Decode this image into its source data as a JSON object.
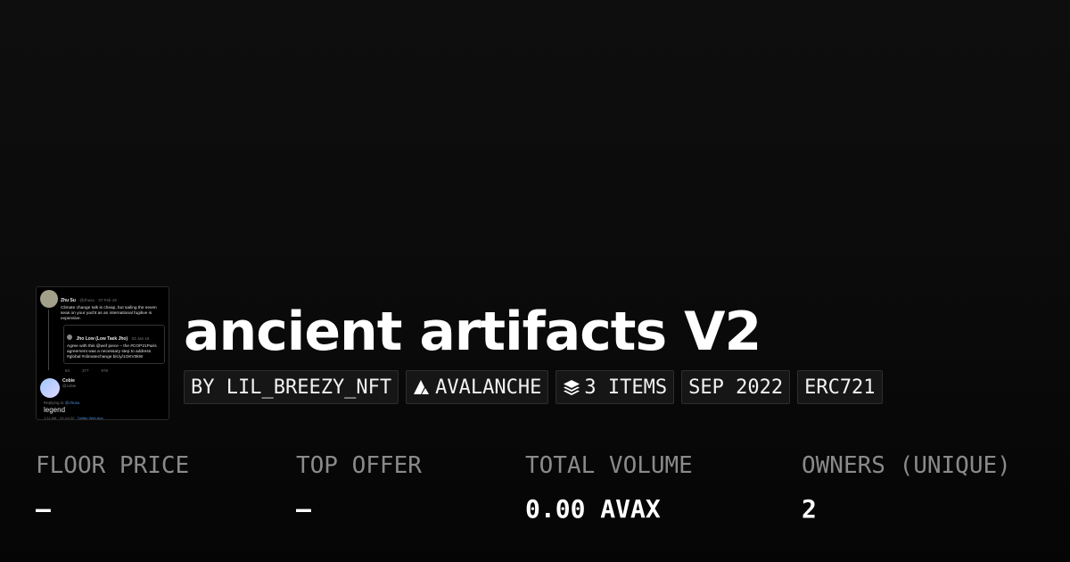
{
  "thumbnail": {
    "tweet": {
      "author": "Zhu Su",
      "handle": "@zhusu",
      "date": "07 Feb 19",
      "text": "Climate change talk is cheap, but sailing the seven seas on your yacht as an international fugitive is expensive."
    },
    "quote": {
      "author": "Jho Low (Low Taek Jho)",
      "date": "03 Jan 16",
      "text": "Agree with this @wef piece – the #COP21Paris agreement was a necessary step to address #global #climatechange bit.ly/1OKV0kW"
    },
    "actions": [
      "94",
      "377",
      "978"
    ],
    "reply": {
      "author": "Cobie",
      "handle": "@cobie",
      "replying_prefix": "Replying to",
      "replying_to": "@zhusu",
      "text": "legend",
      "time": "1:11 AM · 19 Jul 22 ·",
      "client": "Twitter Web App"
    }
  },
  "collection": {
    "title": "ancient artifacts V2",
    "tags": {
      "creator": "BY LIL_BREEZY_NFT",
      "chain": "AVALANCHE",
      "items": "3 ITEMS",
      "date": "SEP 2022",
      "standard": "ERC721"
    }
  },
  "stats": {
    "floor_price": {
      "label": "FLOOR PRICE",
      "value": "–"
    },
    "top_offer": {
      "label": "TOP OFFER",
      "value": "–"
    },
    "total_volume": {
      "label": "TOTAL VOLUME",
      "value": "0.00 AVAX"
    },
    "owners": {
      "label": "OWNERS (UNIQUE)",
      "value": "2"
    }
  },
  "icons": {
    "chain": "avalanche-icon",
    "items": "layers-icon"
  },
  "colors": {
    "background": "#0b0b0b",
    "tag_background": "#161616",
    "label": "#8a8a8a",
    "link": "#4a8fd8"
  }
}
